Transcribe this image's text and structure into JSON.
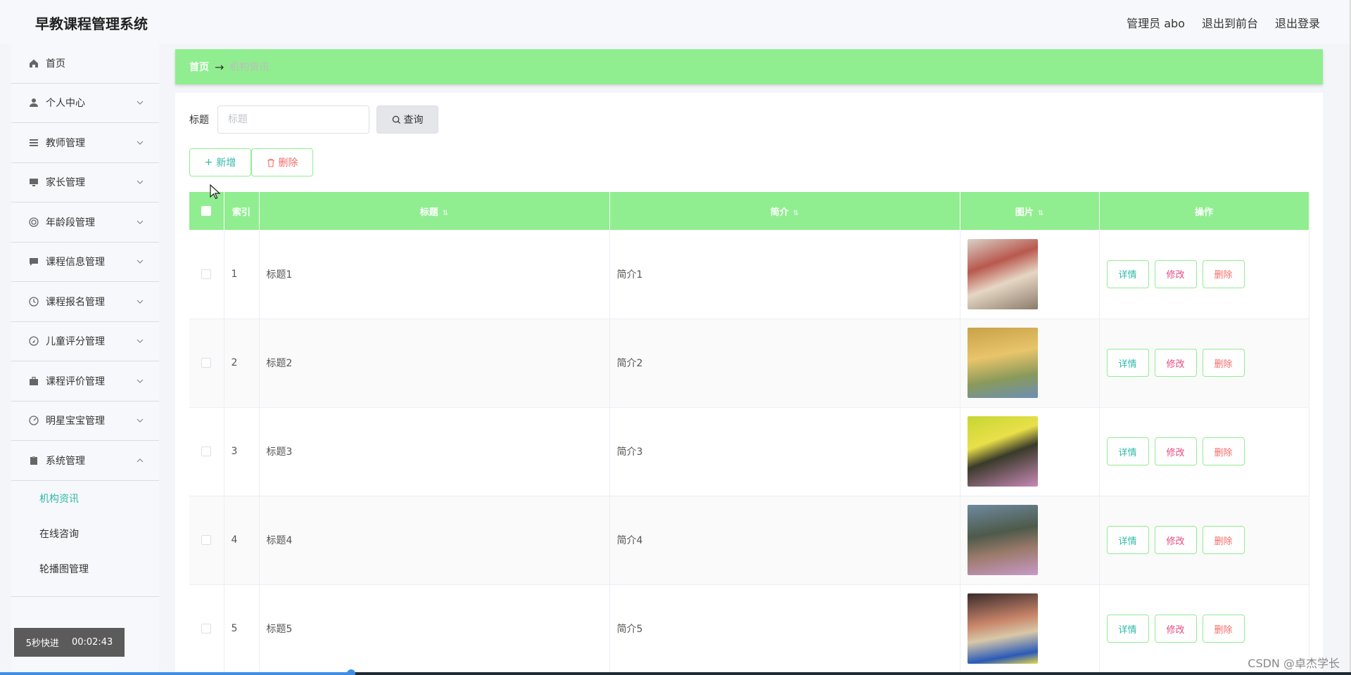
{
  "app": {
    "title": "早教课程管理系统"
  },
  "header": {
    "admin": "管理员 abo",
    "to_front": "退出到前台",
    "logout": "退出登录"
  },
  "sidebar": {
    "items": [
      {
        "label": "首页",
        "icon": "home-icon",
        "expandable": false
      },
      {
        "label": "个人中心",
        "icon": "user-icon",
        "expandable": true
      },
      {
        "label": "教师管理",
        "icon": "list-icon",
        "expandable": true
      },
      {
        "label": "家长管理",
        "icon": "monitor-icon",
        "expandable": true
      },
      {
        "label": "年龄段管理",
        "icon": "target-icon",
        "expandable": true
      },
      {
        "label": "课程信息管理",
        "icon": "chat-icon",
        "expandable": true
      },
      {
        "label": "课程报名管理",
        "icon": "clock-icon",
        "expandable": true
      },
      {
        "label": "儿童评分管理",
        "icon": "compass-icon",
        "expandable": true
      },
      {
        "label": "课程评价管理",
        "icon": "briefcase-icon",
        "expandable": true
      },
      {
        "label": "明星宝宝管理",
        "icon": "gauge-icon",
        "expandable": true
      },
      {
        "label": "系统管理",
        "icon": "clipboard-icon",
        "expandable": true,
        "expanded": true
      }
    ],
    "submenu": [
      {
        "label": "机构资讯",
        "active": true
      },
      {
        "label": "在线咨询",
        "active": false
      },
      {
        "label": "轮播图管理",
        "active": false
      }
    ]
  },
  "breadcrumb": {
    "home": "首页",
    "current": "机构资讯"
  },
  "search": {
    "label": "标题",
    "placeholder": "标题",
    "button": "查询"
  },
  "actions": {
    "add": "新增",
    "delete": "删除"
  },
  "table": {
    "headers": {
      "index": "索引",
      "title": "标题",
      "intro": "简介",
      "image": "图片",
      "ops": "操作"
    },
    "rows": [
      {
        "index": "1",
        "title": "标题1",
        "intro": "简介1"
      },
      {
        "index": "2",
        "title": "标题2",
        "intro": "简介2"
      },
      {
        "index": "3",
        "title": "标题3",
        "intro": "简介3"
      },
      {
        "index": "4",
        "title": "标题4",
        "intro": "简介4"
      },
      {
        "index": "5",
        "title": "标题5",
        "intro": "简介5"
      }
    ],
    "op_labels": {
      "detail": "详情",
      "edit": "修改",
      "delete": "删除"
    }
  },
  "overlay": {
    "speed": "5秒快进",
    "time": "00:02:43",
    "progress": 0.26,
    "watermark": "CSDN @卓杰学长"
  },
  "colors": {
    "accent_green": "#90ee90",
    "link_teal": "#2fb9a8",
    "danger": "#f56c6c"
  }
}
